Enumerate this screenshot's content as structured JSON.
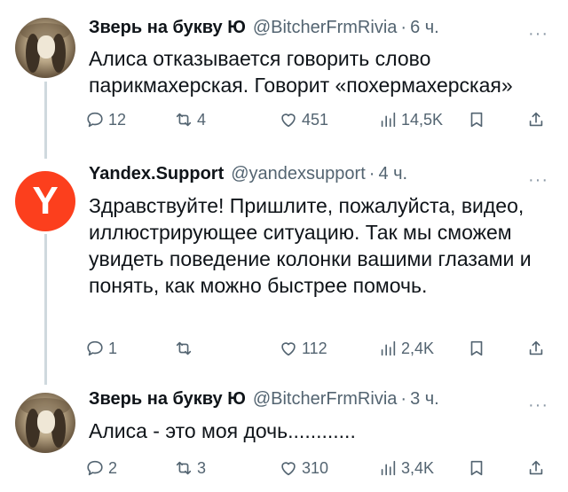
{
  "tweets": [
    {
      "author": "Зверь на букву Ю",
      "handle": "@BitcherFrmRivia",
      "time": "6 ч.",
      "text": "Алиса отказывается говорить слово парикмахерская. Говорит «похермахерская»",
      "replies": "12",
      "retweets": "4",
      "likes": "451",
      "views": "14,5K"
    },
    {
      "author": "Yandex.Support",
      "handle": "@yandexsupport",
      "time": "4 ч.",
      "text": "Здравствуйте! Пришлите, пожалуйста, видео, иллюстрирующее ситуацию. Так мы сможем увидеть поведение колонки вашими глазами и понять, как можно быстрее помочь.",
      "avatar_letter": "Y",
      "replies": "1",
      "retweets": "",
      "likes": "112",
      "views": "2,4K"
    },
    {
      "author": "Зверь на букву Ю",
      "handle": "@BitcherFrmRivia",
      "time": "3 ч.",
      "text": "Алиса - это моя дочь............",
      "replies": "2",
      "retweets": "3",
      "likes": "310",
      "views": "3,4K"
    }
  ],
  "more_glyph": "···",
  "dot": "·",
  "colors": {
    "muted": "#536471",
    "line": "#cfd9de",
    "yandex": "#fc3f1d"
  }
}
